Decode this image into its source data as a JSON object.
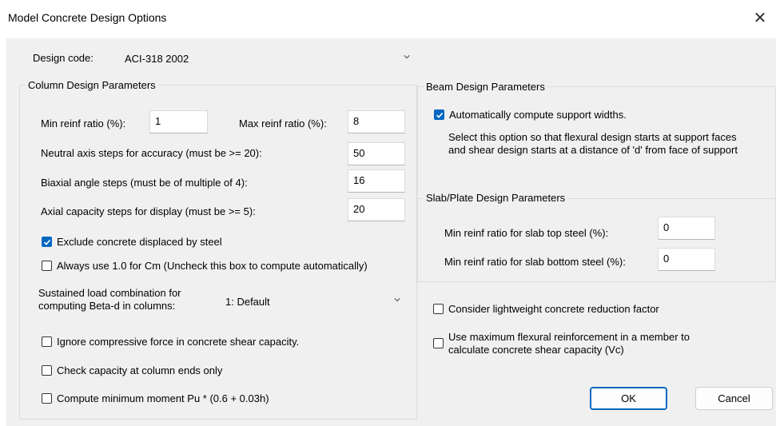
{
  "window": {
    "title": "Model Concrete Design Options",
    "close_glyph": "✕"
  },
  "design_code": {
    "label": "Design code:",
    "value": "ACI-318 2002"
  },
  "column": {
    "group_title": "Column Design Parameters",
    "min_reinf_label": "Min reinf ratio (%):",
    "min_reinf_value": "1",
    "max_reinf_label": "Max reinf ratio (%):",
    "max_reinf_value": "8",
    "neutral_axis_label": "Neutral axis steps for accuracy (must be >= 20):",
    "neutral_axis_value": "50",
    "biaxial_label": "Biaxial angle steps (must be of multiple of 4):",
    "biaxial_value": "16",
    "axial_label": "Axial capacity steps for display (must be >= 5):",
    "axial_value": "20",
    "exclude_concrete": {
      "label": "Exclude concrete displaced by steel",
      "checked": true
    },
    "always_cm": {
      "label": "Always use 1.0 for Cm (Uncheck this box to compute automatically)",
      "checked": false
    },
    "sustained_label_line1": "Sustained load combination for",
    "sustained_label_line2": "computing Beta-d in columns:",
    "sustained_value": "1: Default",
    "ignore_compressive": {
      "label": "Ignore compressive force in concrete shear capacity.",
      "checked": false
    },
    "check_ends": {
      "label": "Check capacity at column ends only",
      "checked": false
    },
    "compute_min_moment": {
      "label": "Compute minimum moment Pu * (0.6 + 0.03h)",
      "checked": false
    }
  },
  "beam": {
    "group_title": "Beam Design Parameters",
    "auto_support": {
      "label": "Automatically compute support widths.",
      "checked": true
    },
    "desc_line1": "Select this option so that flexural design starts at support faces",
    "desc_line2": "and shear design starts at a distance of 'd' from face of support"
  },
  "slab": {
    "group_title": "Slab/Plate Design Parameters",
    "top_label": "Min reinf ratio for slab top steel (%):",
    "top_value": "0",
    "bottom_label": "Min reinf ratio for slab bottom steel (%):",
    "bottom_value": "0"
  },
  "options": {
    "lightweight": {
      "label": "Consider lightweight concrete reduction factor",
      "checked": false
    },
    "max_flexural_line1": "Use maximum flexural reinforcement in a member to",
    "max_flexural_line2": "calculate concrete shear capacity (Vc)",
    "max_flexural_checked": false
  },
  "buttons": {
    "ok": "OK",
    "cancel": "Cancel"
  },
  "colors": {
    "accent": "#0067c0",
    "client_bg": "#f0f0f0"
  }
}
